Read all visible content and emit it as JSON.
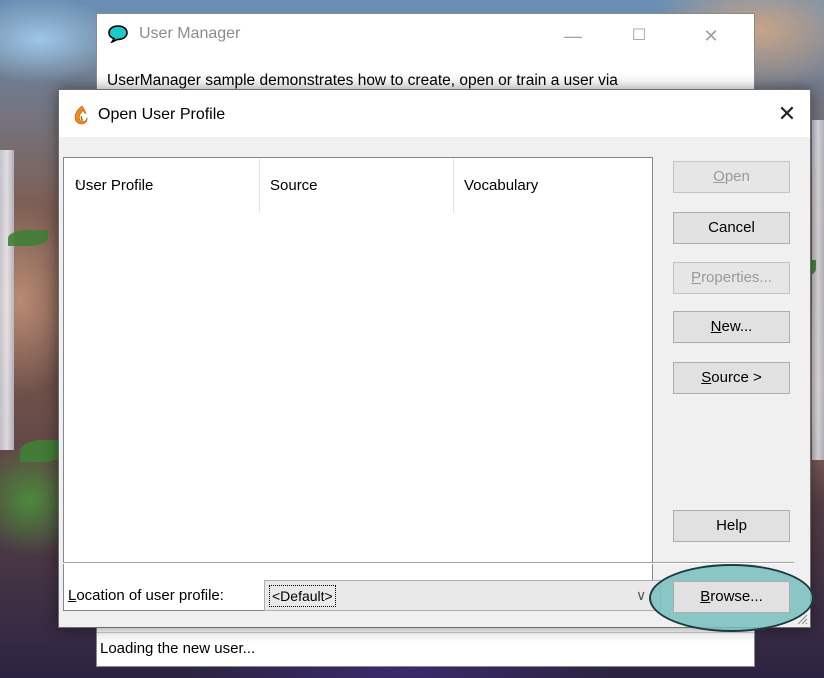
{
  "background_window": {
    "title": "User Manager",
    "description": "UserManager sample demonstrates how to create, open or train a user via",
    "status": "Loading the new user...",
    "minimize_glyph": "—",
    "maximize_glyph": "☐",
    "close_glyph": "✕",
    "icon": "speech-bubble-icon"
  },
  "dialog": {
    "title": "Open User Profile",
    "icon": "dragon-flame-icon",
    "close_glyph": "✕",
    "columns": [
      {
        "label": "User Profile",
        "sort": "ascending"
      },
      {
        "label": "Source"
      },
      {
        "label": "Vocabulary"
      }
    ],
    "rows": [],
    "buttons": {
      "open": {
        "label": "Open",
        "mnemonic": "O",
        "rest": "pen",
        "enabled": false
      },
      "cancel": {
        "label": "Cancel",
        "enabled": true
      },
      "properties": {
        "label": "Properties...",
        "mnemonic": "P",
        "rest": "roperties...",
        "enabled": false
      },
      "new": {
        "label": "New...",
        "mnemonic": "N",
        "rest": "ew...",
        "enabled": true
      },
      "source": {
        "label": "Source >",
        "mnemonic": "S",
        "rest": "ource >",
        "enabled": true
      },
      "help": {
        "label": "Help",
        "enabled": true
      },
      "browse": {
        "label": "Browse...",
        "mnemonic": "B",
        "rest": "rowse...",
        "enabled": true,
        "highlighted": true
      }
    },
    "location": {
      "label": "Location of user profile:",
      "mnemonic": "L",
      "rest": "ocation of user profile:",
      "value": "<Default>",
      "arrow_glyph": "∨"
    },
    "sort_glyph": "^"
  },
  "colors": {
    "highlight_fill": "#78bebe",
    "highlight_stroke": "#1c3b40",
    "dialog_bg": "#f0f0f0",
    "button_bg": "#e1e1e1"
  }
}
